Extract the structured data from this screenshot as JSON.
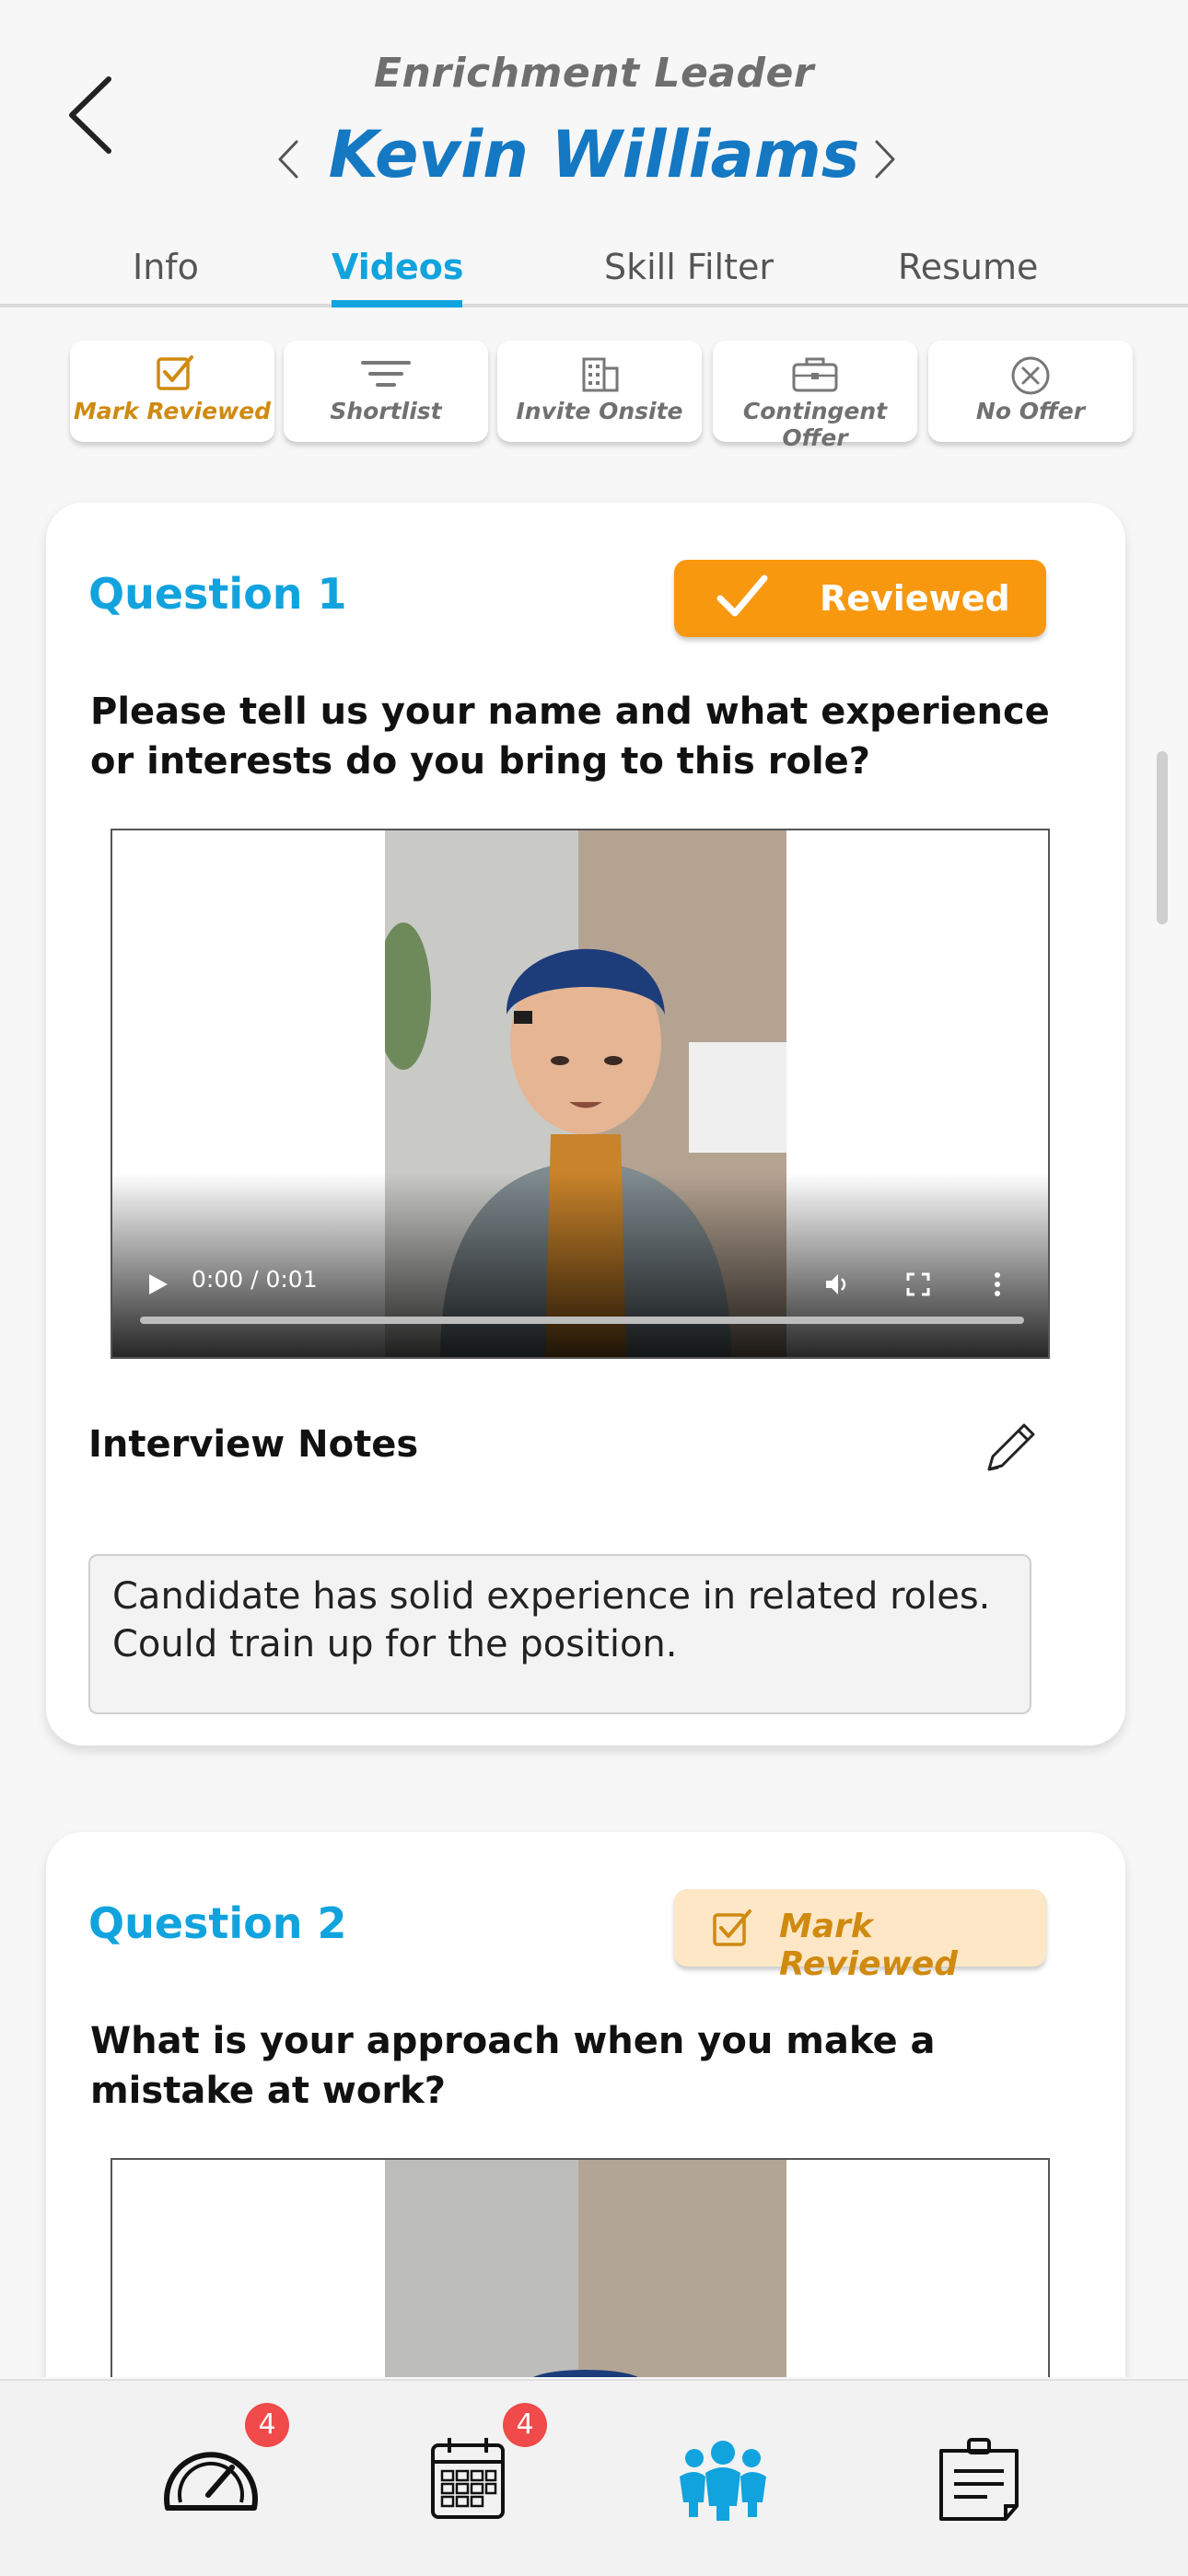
{
  "header": {
    "role": "Enrichment Leader",
    "candidate_name": "Kevin Williams"
  },
  "tabs": [
    {
      "label": "Info",
      "active": false
    },
    {
      "label": "Videos",
      "active": true
    },
    {
      "label": "Skill Filter",
      "active": false
    },
    {
      "label": "Resume",
      "active": false
    }
  ],
  "actions": [
    {
      "label": "Mark Reviewed",
      "icon": "checkbox-check-icon"
    },
    {
      "label": "Shortlist",
      "icon": "filter-lines-icon"
    },
    {
      "label": "Invite Onsite",
      "icon": "building-icon"
    },
    {
      "label": "Contingent Offer",
      "icon": "briefcase-icon"
    },
    {
      "label": "No Offer",
      "icon": "circle-x-icon"
    }
  ],
  "questions": [
    {
      "title": "Question 1",
      "status_label": "Reviewed",
      "text": "Please tell us your name and what experience or interests do you bring to this role?",
      "video_time": "0:00 / 0:01",
      "notes_title": "Interview Notes",
      "notes": "Candidate has solid experience in related roles. Could train up for the position."
    },
    {
      "title": "Question 2",
      "status_label": "Mark Reviewed",
      "text": "What is your approach when you make a mistake at work?"
    }
  ],
  "bottom_nav": [
    {
      "icon": "speedometer-icon",
      "badge": "4"
    },
    {
      "icon": "calendar-icon",
      "badge": "4"
    },
    {
      "icon": "people-icon",
      "active": true
    },
    {
      "icon": "clipboard-notes-icon"
    }
  ],
  "colors": {
    "accent_blue": "#11a3de",
    "name_blue": "#1478c3",
    "orange": "#f7980f",
    "light_orange": "#fde7c6",
    "badge_red": "#f04a4a"
  }
}
